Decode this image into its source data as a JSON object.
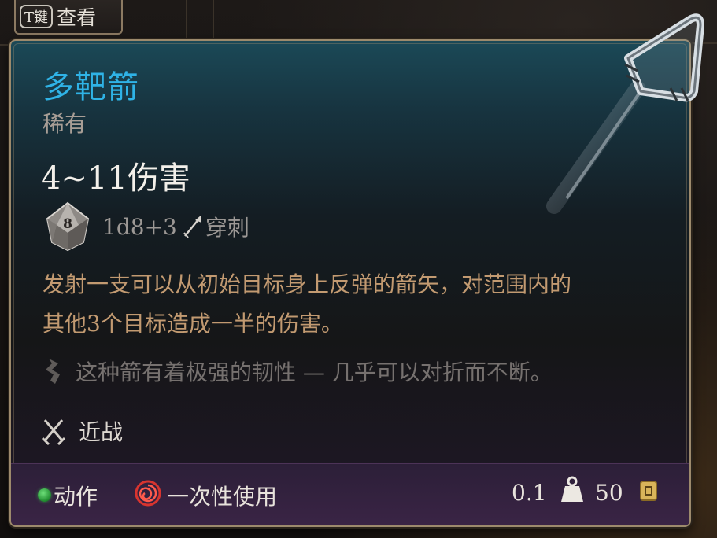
{
  "hint": {
    "key": "T键",
    "label": "查看"
  },
  "item": {
    "name": "多靶箭",
    "rarity": "稀有",
    "damage": "4~11伤害",
    "dice_face": "8",
    "dice_formula": "1d8+3",
    "damage_type": "穿刺",
    "description_lines": [
      "发射一支可以从初始目标身上反弹的箭矢，对范围内的",
      "其他3个目标造成一半的伤害。"
    ],
    "flavor": "这种箭有着极强的韧性 — 几乎可以对折而不断。",
    "property": "近战"
  },
  "footer": {
    "action": "动作",
    "usage": "一次性使用",
    "weight": "0.1",
    "price": "50"
  },
  "colors": {
    "name": "#2fb3e6",
    "description": "#c29a71",
    "border": "#9d8a6c",
    "action_dot": "#2fa33f"
  },
  "icons": {
    "dice": "d10-dice-icon",
    "damage_type": "arrow-pierce-icon",
    "flavor": "scroll-quote-icon",
    "property": "crossed-swords-icon",
    "usage": "spiral-consumable-icon",
    "weight": "weight-icon",
    "price": "gold-coin-icon",
    "item": "arrow-item-art"
  }
}
